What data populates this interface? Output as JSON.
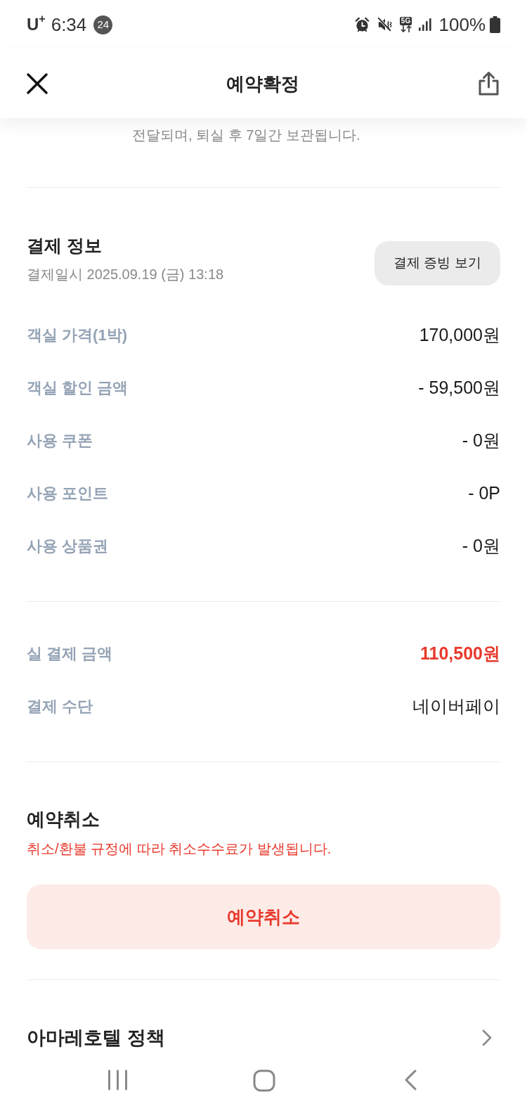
{
  "status_bar": {
    "carrier": "U$^{+}$",
    "time": "6:34",
    "notification_count": "24",
    "network": "5G",
    "battery": "100%"
  },
  "header": {
    "title": "예약확정"
  },
  "notice_partial": "전달되며, 퇴실 후 7일간 보관됩니다.",
  "payment": {
    "title": "결제 정보",
    "date": "결제일시 2025.09.19 (금) 13:18",
    "receipt_button": "결제 증빙 보기",
    "items": [
      {
        "label": "객실 가격(1박)",
        "value": "170,000원"
      },
      {
        "label": "객실 할인 금액",
        "value": "- 59,500원"
      },
      {
        "label": "사용 쿠폰",
        "value": "- 0원"
      },
      {
        "label": "사용 포인트",
        "value": "- 0P"
      },
      {
        "label": "사용 상품권",
        "value": "- 0원"
      }
    ],
    "summary": [
      {
        "label": "실 결제 금액",
        "value": "110,500원",
        "emphasis": true
      },
      {
        "label": "결제 수단",
        "value": "네이버페이",
        "emphasis": false
      }
    ]
  },
  "cancel": {
    "title": "예약취소",
    "notice": "취소/환불 규정에 따라 취소수수료가 발생됩니다.",
    "button": "예약취소"
  },
  "policy": {
    "label": "아마레호텔 정책"
  }
}
